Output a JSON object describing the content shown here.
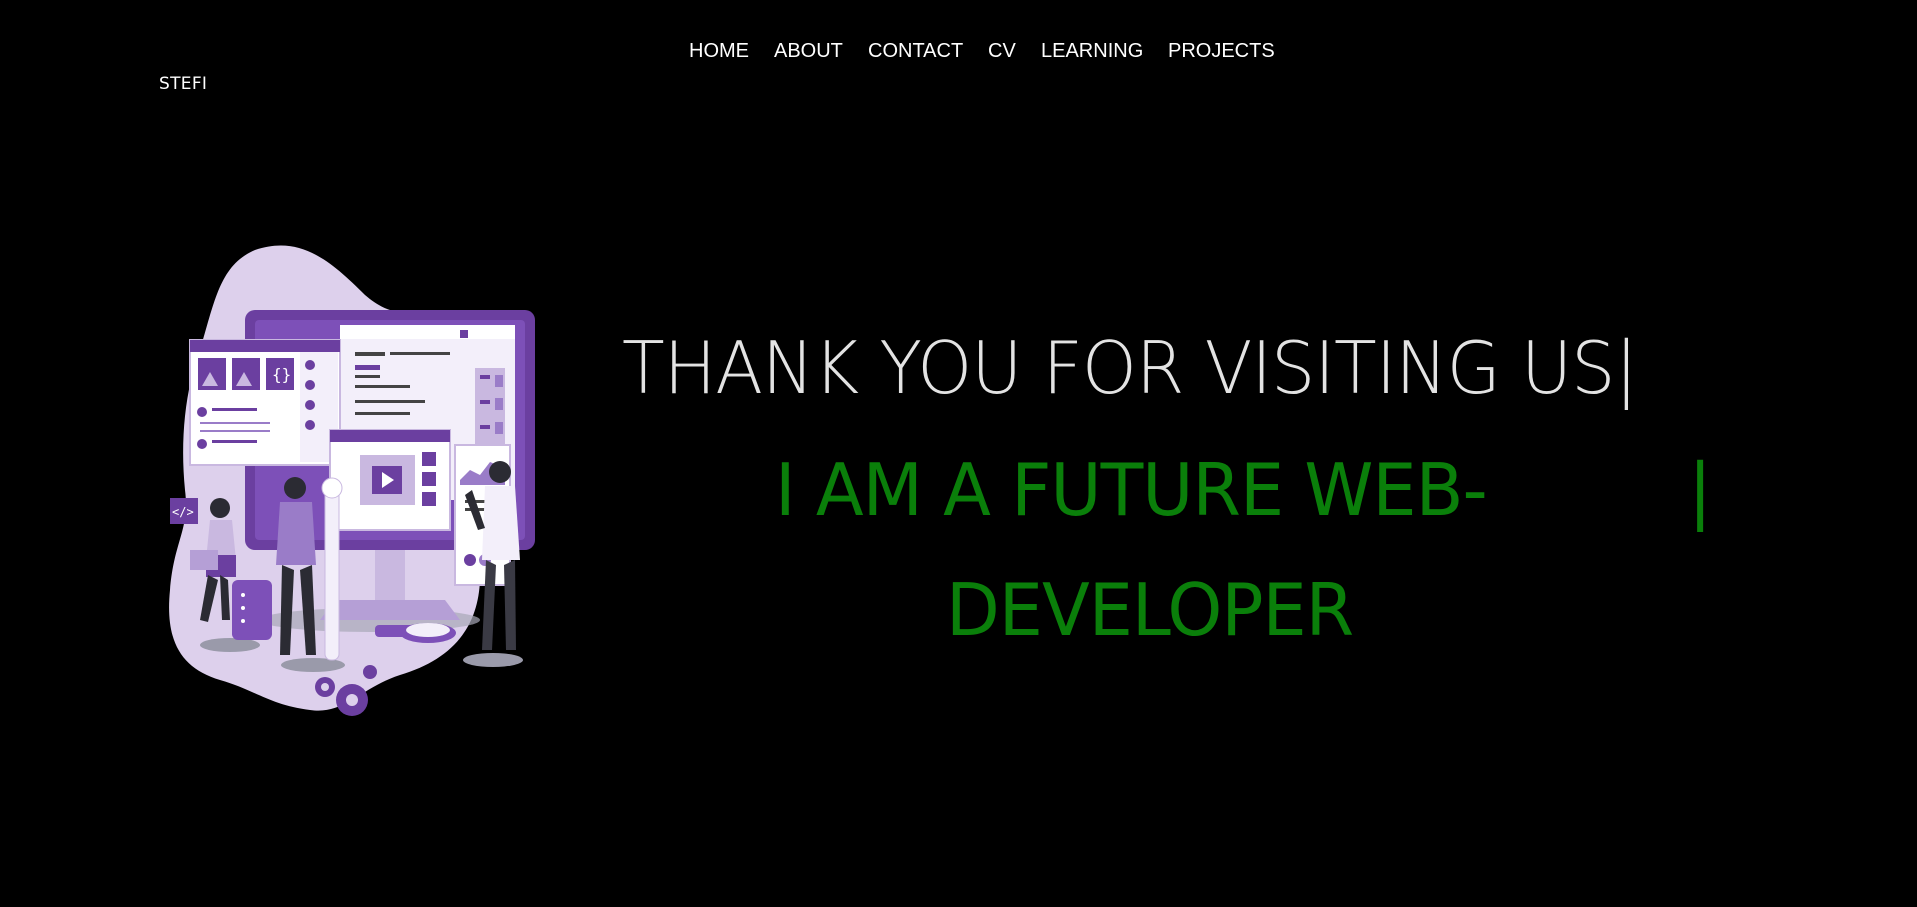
{
  "nav": {
    "items": [
      {
        "label": "HOME"
      },
      {
        "label": "ABOUT"
      },
      {
        "label": "CONTACT"
      },
      {
        "label": "CV"
      },
      {
        "label": "LEARNING"
      },
      {
        "label": "PROJECTS"
      }
    ]
  },
  "brand": {
    "name": "STEFI"
  },
  "hero": {
    "headline": "THANK YOU FOR VISITING US",
    "headline_caret": "|",
    "tagline_line1": "I AM A FUTURE WEB-",
    "tagline_caret": "|",
    "tagline_line2": "DEVELOPER",
    "illustration_icon": "web-development-team-illustration"
  },
  "colors": {
    "background": "#000000",
    "headline": "#e3e3e3",
    "tagline": "#0a7f0a",
    "accent_purple": "#6b3fa0",
    "light_purple": "#ddd0ec"
  }
}
